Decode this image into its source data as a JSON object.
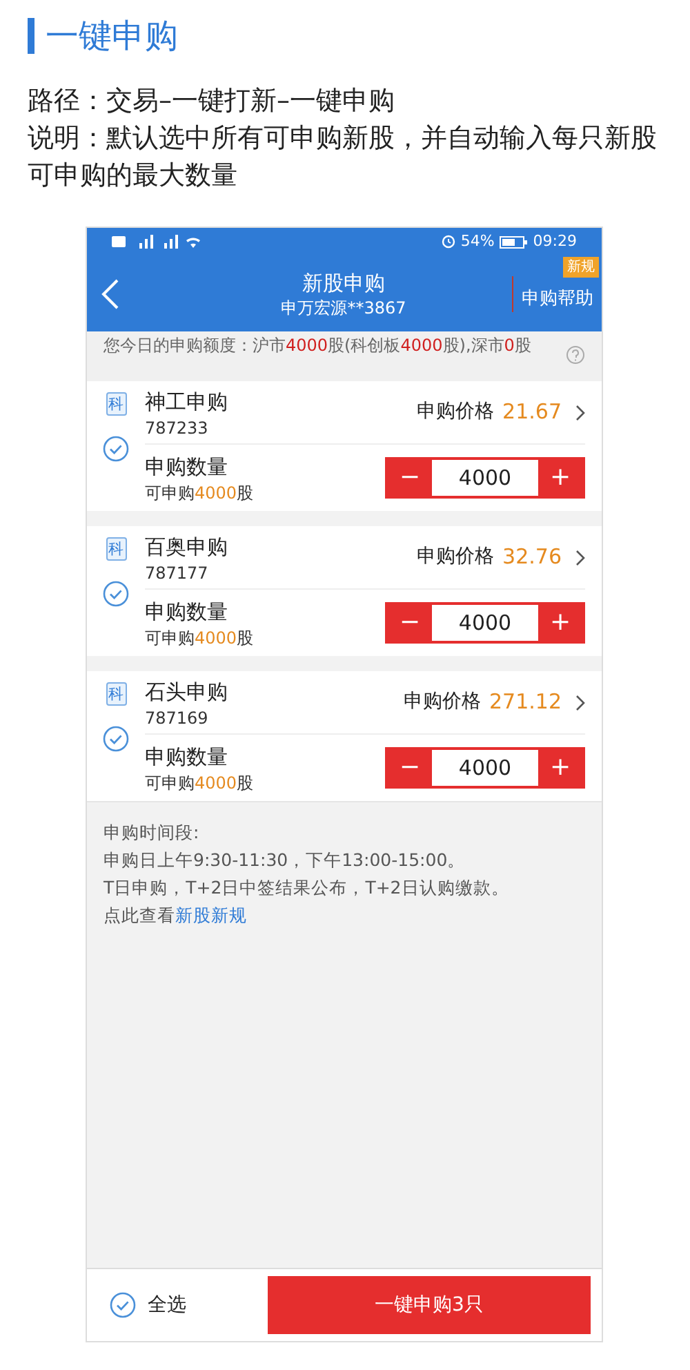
{
  "heading": "一键申购",
  "intro": [
    "路径：交易–一键打新–一键申购",
    "说明：默认选中所有可申购新股，并自动输入每只新股可申购的最大数量"
  ],
  "status_bar": {
    "battery": "54%",
    "time": "09:29"
  },
  "nav": {
    "title": "新股申购",
    "subtitle": "申万宏源**3867",
    "help": "申购帮助",
    "help_badge": "新规"
  },
  "quota": [
    {
      "text": "您今日的申购额度：沪市",
      "highlight": false
    },
    {
      "text": "4000",
      "highlight": true
    },
    {
      "text": "股(科创板",
      "highlight": false
    },
    {
      "text": "4000",
      "highlight": true
    },
    {
      "text": "股),深市",
      "highlight": false
    },
    {
      "text": "0",
      "highlight": true
    },
    {
      "text": "股",
      "highlight": false
    }
  ],
  "stocks": [
    {
      "board": "科",
      "name": "神工申购",
      "code": "787233",
      "checked": true,
      "price_label": "申购价格",
      "price": "21.67",
      "qty_label": "申购数量",
      "avail_prefix": "可申购",
      "avail_amount": "4000",
      "avail_suffix": "股",
      "minus": "−",
      "quantity": "4000",
      "plus": "+"
    },
    {
      "board": "科",
      "name": "百奥申购",
      "code": "787177",
      "checked": true,
      "price_label": "申购价格",
      "price": "32.76",
      "qty_label": "申购数量",
      "avail_prefix": "可申购",
      "avail_amount": "4000",
      "avail_suffix": "股",
      "minus": "−",
      "quantity": "4000",
      "plus": "+"
    },
    {
      "board": "科",
      "name": "石头申购",
      "code": "787169",
      "checked": true,
      "price_label": "申购价格",
      "price": "271.12",
      "qty_label": "申购数量",
      "avail_prefix": "可申购",
      "avail_amount": "4000",
      "avail_suffix": "股",
      "minus": "−",
      "quantity": "4000",
      "plus": "+"
    }
  ],
  "info": {
    "title": "申购时间段:",
    "lines": [
      "申购日上午9:30-11:30，下午13:00-15:00。",
      "T日申购，T+2日中签结果公布，T+2日认购缴款。"
    ],
    "link_prefix": "点此查看",
    "link": "新股新规"
  },
  "footer": {
    "select_all": "全选",
    "select_all_checked": true,
    "submit": "一键申购3只"
  }
}
